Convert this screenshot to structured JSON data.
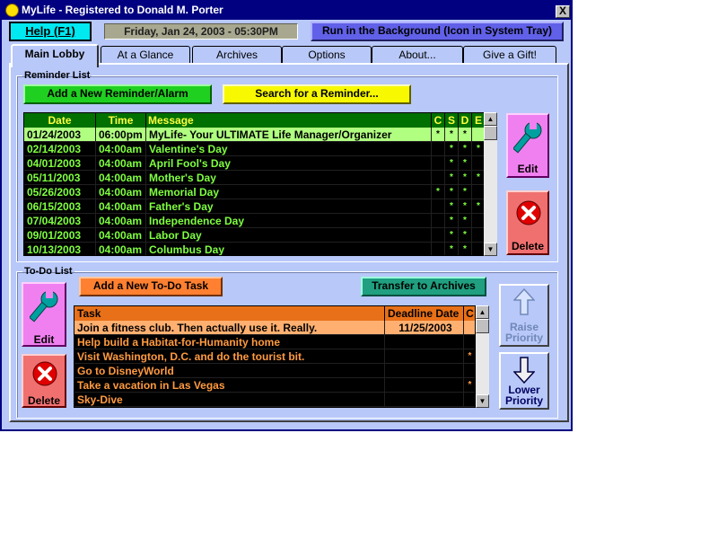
{
  "window": {
    "title": "MyLife - Registered to Donald M. Porter",
    "close_glyph": "X"
  },
  "topbar": {
    "help_label": "Help (F1)",
    "datetime": "Friday, Jan 24, 2003 - 05:30PM",
    "background_label": "Run in the Background (Icon in System Tray)"
  },
  "tabs": [
    {
      "label": "Main Lobby",
      "active": true
    },
    {
      "label": "At a Glance",
      "active": false
    },
    {
      "label": "Archives",
      "active": false
    },
    {
      "label": "Options",
      "active": false
    },
    {
      "label": "About...",
      "active": false
    },
    {
      "label": "Give a Gift!",
      "active": false
    }
  ],
  "reminders": {
    "legend": "Reminder List",
    "add_label": "Add a New Reminder/Alarm",
    "search_label": "Search for a Reminder...",
    "columns": {
      "date": "Date",
      "time": "Time",
      "message": "Message",
      "c": "C",
      "s": "S",
      "d": "D",
      "e": "E"
    },
    "rows": [
      {
        "date": "01/24/2003",
        "time": "06:00pm",
        "message": "MyLife- Your ULTIMATE Life Manager/Organizer",
        "c": "*",
        "s": "*",
        "d": "*",
        "e": "",
        "selected": true
      },
      {
        "date": "02/14/2003",
        "time": "04:00am",
        "message": "Valentine's Day",
        "c": "",
        "s": "*",
        "d": "*",
        "e": "*",
        "selected": false
      },
      {
        "date": "04/01/2003",
        "time": "04:00am",
        "message": "April Fool's Day",
        "c": "",
        "s": "*",
        "d": "*",
        "e": "",
        "selected": false
      },
      {
        "date": "05/11/2003",
        "time": "04:00am",
        "message": "Mother's Day",
        "c": "",
        "s": "*",
        "d": "*",
        "e": "*",
        "selected": false
      },
      {
        "date": "05/26/2003",
        "time": "04:00am",
        "message": "Memorial Day",
        "c": "*",
        "s": "*",
        "d": "*",
        "e": "",
        "selected": false
      },
      {
        "date": "06/15/2003",
        "time": "04:00am",
        "message": "Father's Day",
        "c": "",
        "s": "*",
        "d": "*",
        "e": "*",
        "selected": false
      },
      {
        "date": "07/04/2003",
        "time": "04:00am",
        "message": "Independence Day",
        "c": "",
        "s": "*",
        "d": "*",
        "e": "",
        "selected": false
      },
      {
        "date": "09/01/2003",
        "time": "04:00am",
        "message": "Labor Day",
        "c": "",
        "s": "*",
        "d": "*",
        "e": "",
        "selected": false
      },
      {
        "date": "10/13/2003",
        "time": "04:00am",
        "message": "Columbus Day",
        "c": "",
        "s": "*",
        "d": "*",
        "e": "",
        "selected": false
      }
    ],
    "edit_label": "Edit",
    "delete_label": "Delete"
  },
  "todo": {
    "legend": "To-Do List",
    "add_label": "Add a New To-Do Task",
    "transfer_label": "Transfer to Archives",
    "columns": {
      "task": "Task",
      "deadline": "Deadline Date",
      "c": "C"
    },
    "rows": [
      {
        "task": "Join a fitness club.  Then actually use it.  Really.",
        "deadline": "11/25/2003",
        "c": "",
        "selected": true
      },
      {
        "task": "Help build a Habitat-for-Humanity home",
        "deadline": "",
        "c": "",
        "selected": false
      },
      {
        "task": "Visit Washington, D.C. and do the tourist bit.",
        "deadline": "",
        "c": "*",
        "selected": false
      },
      {
        "task": "Go to DisneyWorld",
        "deadline": "",
        "c": "",
        "selected": false
      },
      {
        "task": "Take a vacation in Las Vegas",
        "deadline": "",
        "c": "*",
        "selected": false
      },
      {
        "task": "Sky-Dive",
        "deadline": "",
        "c": "",
        "selected": false
      }
    ],
    "edit_label": "Edit",
    "delete_label": "Delete",
    "raise_label_1": "Raise",
    "raise_label_2": "Priority",
    "lower_label_1": "Lower",
    "lower_label_2": "Priority"
  },
  "icons": {
    "title": "sun-icon",
    "edit": "wrench-icon",
    "delete": "red-x-icon",
    "raise": "up-arrow-icon",
    "lower": "down-arrow-icon"
  },
  "colors": {
    "client_bg": "#b8c8f8",
    "reminder_text": "#7fff40",
    "todo_text": "#ff9a40",
    "add_reminder_btn": "#20d020",
    "search_btn": "#f8f800",
    "add_todo_btn": "#ff8030",
    "transfer_btn": "#20a080"
  }
}
